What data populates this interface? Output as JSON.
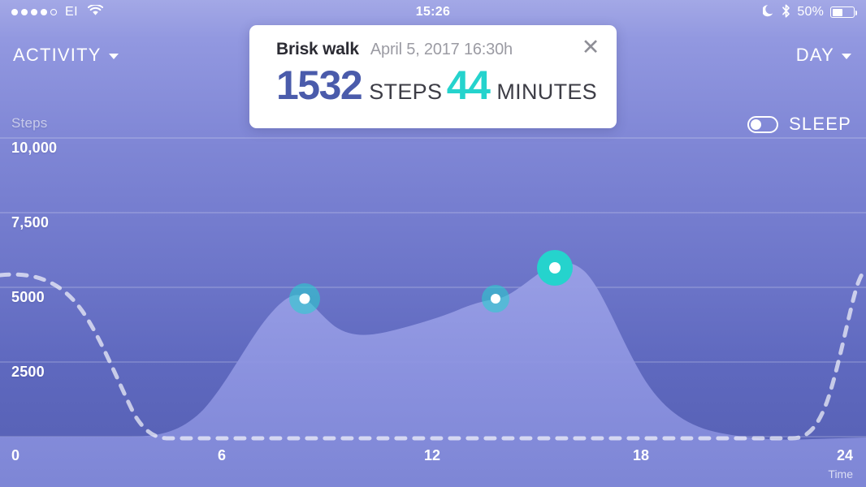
{
  "status_bar": {
    "signal_dots_filled": 4,
    "signal_dots_total": 5,
    "carrier": "EI",
    "wifi_icon": "wifi-icon",
    "time": "15:26",
    "moon_icon": "moon-icon",
    "bluetooth_icon": "bluetooth-icon",
    "battery_percent": "50%",
    "battery_icon": "battery-icon"
  },
  "header": {
    "left_menu_label": "ACTIVITY",
    "right_menu_label": "DAY",
    "sleep_toggle_label": "SLEEP",
    "sleep_toggle_state": "off"
  },
  "card": {
    "title": "Brisk walk",
    "date": "April 5, 2017 16:30h",
    "close_icon": "✕",
    "steps_value": "1532",
    "steps_unit": "STEPS",
    "minutes_value": "44",
    "minutes_unit": "MINUTES",
    "steps_color": "#4a5bab",
    "minutes_color": "#25d3cd"
  },
  "colors": {
    "bg_top": "#a3a8e6",
    "bg_bottom": "#555fb4",
    "area_fill": "#8f96e0",
    "teal": "#25d3cd",
    "indigo": "#4a5bab",
    "gridline": "rgba(255,255,255,0.22)",
    "dashed_line": "rgba(255,255,255,0.62)"
  },
  "chart_data": {
    "type": "area",
    "title": "",
    "xlabel": "Time",
    "ylabel": "Steps",
    "xlim": [
      0,
      24
    ],
    "ylim": [
      0,
      11000
    ],
    "grid": true,
    "legend": "none",
    "x_ticks": [
      "0",
      "6",
      "12",
      "18",
      "24"
    ],
    "x_tick_values": [
      0,
      6,
      12,
      18,
      24
    ],
    "y_ticks": [
      "10,000",
      "7,500",
      "5000",
      "2500"
    ],
    "y_tick_values": [
      10000,
      7500,
      5000,
      2500
    ],
    "series": [
      {
        "name": "Steps",
        "type": "area",
        "x": [
          0,
          1,
          2,
          3,
          4,
          5,
          6,
          7,
          8,
          9,
          10,
          11,
          12,
          13,
          14,
          15,
          16,
          17,
          18,
          19,
          20,
          21,
          22,
          23,
          24
        ],
        "values": [
          0,
          0,
          0,
          0,
          120,
          520,
          1450,
          3100,
          4450,
          4870,
          4400,
          3950,
          3900,
          4150,
          4700,
          5100,
          5800,
          5750,
          4600,
          2500,
          1250,
          620,
          280,
          110,
          40
        ]
      },
      {
        "name": "Sleep",
        "type": "dashed-line",
        "x": [
          0,
          1,
          2,
          3,
          4,
          5,
          6,
          7,
          8,
          9,
          10,
          11,
          12,
          13,
          14,
          15,
          16,
          17,
          18,
          19,
          20,
          21,
          22,
          23,
          24
        ],
        "values": [
          5700,
          5600,
          4200,
          600,
          60,
          40,
          40,
          40,
          40,
          40,
          40,
          40,
          40,
          40,
          40,
          40,
          40,
          40,
          40,
          40,
          40,
          60,
          900,
          4600,
          5650
        ]
      }
    ],
    "markers": [
      {
        "name": "marker-morning",
        "x": 8.45,
        "y": 4880,
        "style": "translucent",
        "selected": false,
        "radius": 19
      },
      {
        "name": "marker-midday",
        "x": 13.7,
        "y": 4900,
        "style": "translucent",
        "selected": false,
        "radius": 17
      },
      {
        "name": "marker-selected",
        "x": 15.4,
        "y": 5810,
        "style": "solid",
        "selected": true,
        "radius": 22
      }
    ]
  }
}
